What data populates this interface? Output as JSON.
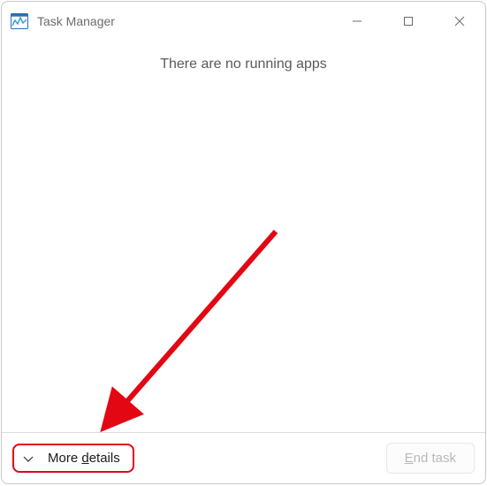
{
  "window": {
    "title": "Task Manager"
  },
  "content": {
    "empty_message": "There are no running apps"
  },
  "footer": {
    "more_details_prefix": "More ",
    "more_details_accel": "d",
    "more_details_suffix": "etails",
    "end_task_accel": "E",
    "end_task_suffix": "nd task"
  }
}
